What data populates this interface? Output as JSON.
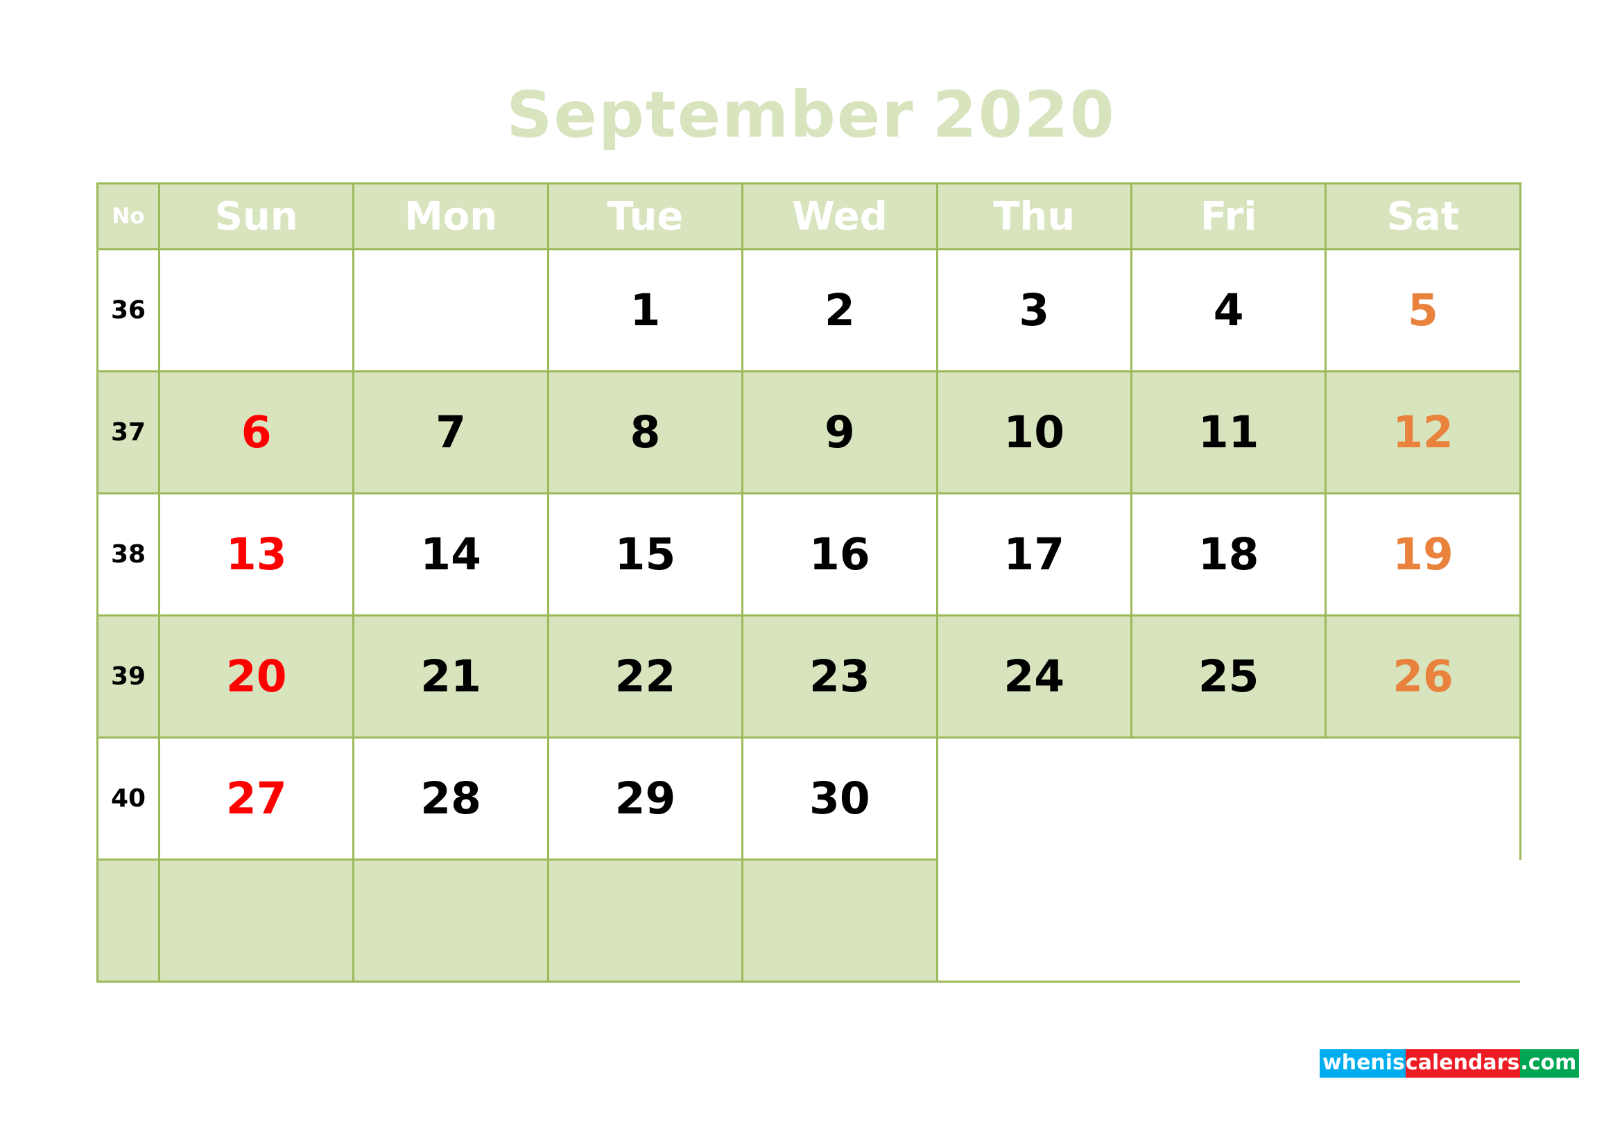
{
  "title": {
    "month": "September",
    "year": "2020",
    "full": "September 2020",
    "color": "#d8e4bd"
  },
  "theme": {
    "grid_line": "#9cba5a",
    "header_bg": "#d8e4bd",
    "header_text": "#ffffff",
    "shaded_row_bg": "#d8e4bd",
    "plain_row_bg": "#ffffff",
    "sunday_color": "#ff0000",
    "saturday_color": "#e8823c",
    "weekday_color": "#000000"
  },
  "header": {
    "week_col_label": "No",
    "days": [
      "Sun",
      "Mon",
      "Tue",
      "Wed",
      "Thu",
      "Fri",
      "Sat"
    ]
  },
  "weeks": [
    {
      "no": "36",
      "shaded": false,
      "days": [
        "",
        "",
        "1",
        "2",
        "3",
        "4",
        "5"
      ]
    },
    {
      "no": "37",
      "shaded": true,
      "days": [
        "6",
        "7",
        "8",
        "9",
        "10",
        "11",
        "12"
      ]
    },
    {
      "no": "38",
      "shaded": false,
      "days": [
        "13",
        "14",
        "15",
        "16",
        "17",
        "18",
        "19"
      ]
    },
    {
      "no": "39",
      "shaded": true,
      "days": [
        "20",
        "21",
        "22",
        "23",
        "24",
        "25",
        "26"
      ]
    },
    {
      "no": "40",
      "shaded": false,
      "days": [
        "27",
        "28",
        "29",
        "30",
        "",
        "",
        ""
      ]
    },
    {
      "no": "",
      "shaded": true,
      "days": [
        "",
        "",
        "",
        "",
        "",
        "",
        ""
      ]
    }
  ],
  "logo": {
    "part1": "whenis",
    "part2": "calendars",
    "part3": ".com",
    "color1": "#00aeef",
    "color2": "#ed1c24",
    "color3": "#00a651"
  }
}
